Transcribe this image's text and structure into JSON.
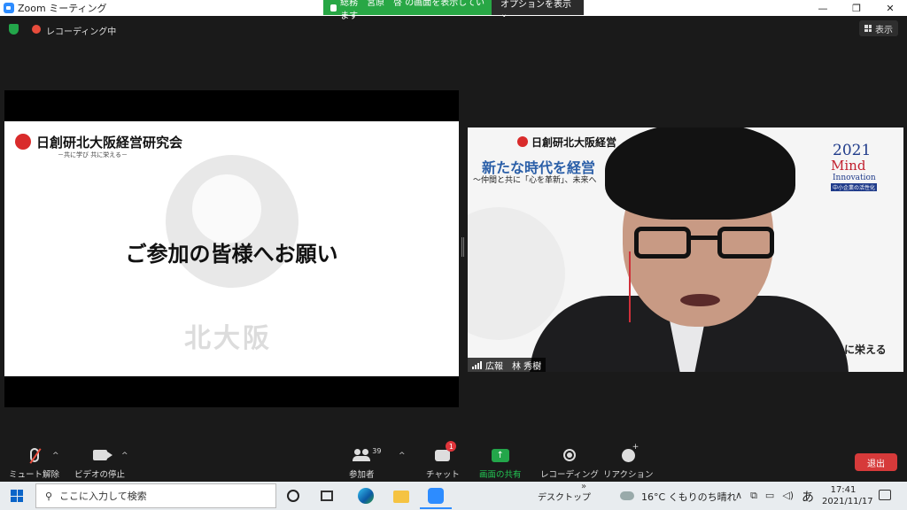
{
  "window": {
    "title": "Zoom ミーティング",
    "share_banner": "総務　宮原　啓 の画面を表示しています",
    "options_label": "オプションを表示 ⌄",
    "btn_min": "—",
    "btn_restore": "❐",
    "btn_close": "✕"
  },
  "topbar": {
    "recording_label": "レコーディング中",
    "view_label": "表示"
  },
  "shared_slide": {
    "org_name": "日創研北大阪経営研究会",
    "org_tagline": "－共に学び 共に栄える－",
    "headline": "ご参加の皆様へお願い",
    "watermark_text": "北大阪"
  },
  "video": {
    "bg_org": "日創研北大阪経営",
    "bg_title": "新たな時代を経営",
    "bg_subtitle": "～仲間と共に「心を革新」、未来へ",
    "badge_year": "2021",
    "badge_mind": "Mind",
    "badge_innovation": "Innovation",
    "badge_tag": "中小企業の活性化",
    "bg_tail": "に栄える",
    "participant_name": "広報　林 秀樹"
  },
  "toolbar": {
    "mute": "ミュート解除",
    "video": "ビデオの停止",
    "participants": "参加者",
    "participants_count": "39",
    "chat": "チャット",
    "chat_badge": "1",
    "share": "画面の共有",
    "record": "レコーディング",
    "reaction": "リアクション",
    "leave": "退出",
    "caret": "^"
  },
  "taskbar": {
    "search_placeholder": "ここに入力して検索",
    "desktop_label": "デスクトップ",
    "chevron": "»",
    "weather": "16°C くもりのち晴れ",
    "tray_up": "∧",
    "ime": "あ",
    "time": "17:41",
    "date": "2021/11/17"
  },
  "colors": {
    "accent_green": "#23a64a",
    "zoom_blue": "#2d8cff",
    "leave_red": "#d63a3a",
    "recording_red": "#e74c3c"
  }
}
